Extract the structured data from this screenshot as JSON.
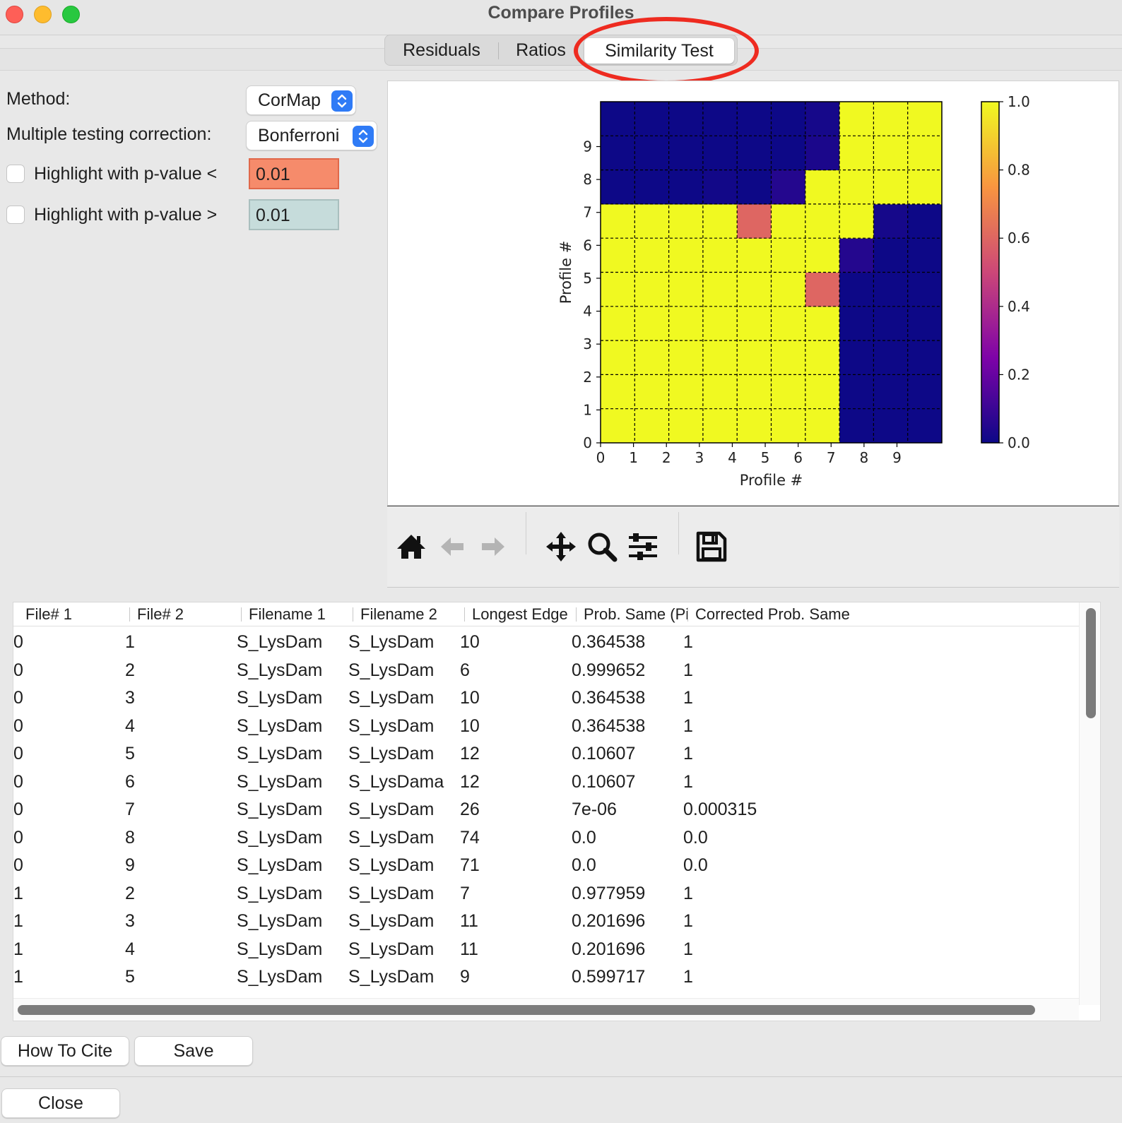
{
  "window": {
    "title": "Compare Profiles"
  },
  "tabs": [
    {
      "label": "Residuals"
    },
    {
      "label": "Ratios"
    },
    {
      "label": "Similarity Test",
      "selected": true
    }
  ],
  "controls": {
    "method_label": "Method:",
    "method_value": "CorMap",
    "correction_label": "Multiple testing correction:",
    "correction_value": "Bonferroni",
    "highlight_lt_label": "Highlight with p-value <",
    "highlight_lt_value": "0.01",
    "highlight_lt_checked": false,
    "highlight_lt_color": "#f68b6b",
    "highlight_gt_label": "Highlight with p-value >",
    "highlight_gt_value": "0.01",
    "highlight_gt_checked": false,
    "highlight_gt_color": "#c6dcdb"
  },
  "chart_data": {
    "type": "heatmap",
    "title": "",
    "xlabel": "Profile #",
    "ylabel": "Profile #",
    "x_ticks": [
      "0",
      "1",
      "2",
      "3",
      "4",
      "5",
      "6",
      "7",
      "8",
      "9"
    ],
    "y_ticks": [
      "0",
      "1",
      "2",
      "3",
      "4",
      "5",
      "6",
      "7",
      "8",
      "9"
    ],
    "xlim": [
      0,
      10
    ],
    "ylim": [
      0,
      10
    ],
    "grid": true,
    "colormap": "plasma",
    "colorbar": {
      "min": 0.0,
      "max": 1.0,
      "ticks": [
        "0.0",
        "0.2",
        "0.4",
        "0.6",
        "0.8",
        "1.0"
      ]
    },
    "matrix_rows_bottom_to_top": [
      [
        1,
        1,
        1,
        1,
        1,
        1,
        1,
        0,
        0,
        0
      ],
      [
        1,
        1,
        1,
        1,
        1,
        1,
        1,
        0,
        0,
        0
      ],
      [
        1,
        1,
        1,
        1,
        1,
        1,
        1,
        0,
        0,
        0
      ],
      [
        1,
        1,
        1,
        1,
        1,
        1,
        1,
        0,
        0,
        0
      ],
      [
        1,
        1,
        1,
        1,
        1,
        1,
        0.6,
        0,
        0,
        0
      ],
      [
        1,
        1,
        1,
        1,
        1,
        1,
        1,
        0.05,
        0,
        0
      ],
      [
        1,
        1,
        1,
        1,
        0.6,
        1,
        1,
        1,
        0.02,
        0
      ],
      [
        0,
        0,
        0,
        0.01,
        0,
        0.05,
        1,
        1,
        1,
        1
      ],
      [
        0,
        0,
        0,
        0,
        0,
        0,
        0.03,
        1,
        1,
        1
      ],
      [
        0,
        0,
        0,
        0,
        0,
        0,
        0.02,
        1,
        1,
        1
      ]
    ]
  },
  "plot_toolbar": [
    {
      "icon": "home-icon"
    },
    {
      "icon": "back-arrow-icon"
    },
    {
      "icon": "forward-arrow-icon"
    },
    {
      "icon": "pan-icon"
    },
    {
      "icon": "zoom-icon"
    },
    {
      "icon": "configure-icon"
    },
    {
      "icon": "save-icon"
    }
  ],
  "table": {
    "columns": [
      "File# 1",
      "File# 2",
      "Filename 1",
      "Filename 2",
      "Longest Edge",
      "Prob. Same (Pi",
      "Corrected Prob. Same"
    ],
    "rows": [
      [
        "0",
        "1",
        "S_LysDam",
        "S_LysDam",
        "10",
        "0.364538",
        "1"
      ],
      [
        "0",
        "2",
        "S_LysDam",
        "S_LysDam",
        "6",
        "0.999652",
        "1"
      ],
      [
        "0",
        "3",
        "S_LysDam",
        "S_LysDam",
        "10",
        "0.364538",
        "1"
      ],
      [
        "0",
        "4",
        "S_LysDam",
        "S_LysDam",
        "10",
        "0.364538",
        "1"
      ],
      [
        "0",
        "5",
        "S_LysDam",
        "S_LysDam",
        "12",
        "0.10607",
        "1"
      ],
      [
        "0",
        "6",
        "S_LysDam",
        "S_LysDama",
        "12",
        "0.10607",
        "1"
      ],
      [
        "0",
        "7",
        "S_LysDam",
        "S_LysDam",
        "26",
        "7e-06",
        "0.000315"
      ],
      [
        "0",
        "8",
        "S_LysDam",
        "S_LysDam",
        "74",
        "0.0",
        "0.0"
      ],
      [
        "0",
        "9",
        "S_LysDam",
        "S_LysDam",
        "71",
        "0.0",
        "0.0"
      ],
      [
        "1",
        "2",
        "S_LysDam",
        "S_LysDam",
        "7",
        "0.977959",
        "1"
      ],
      [
        "1",
        "3",
        "S_LysDam",
        "S_LysDam",
        "11",
        "0.201696",
        "1"
      ],
      [
        "1",
        "4",
        "S_LysDam",
        "S_LysDam",
        "11",
        "0.201696",
        "1"
      ],
      [
        "1",
        "5",
        "S_LysDam",
        "S_LysDam",
        "9",
        "0.599717",
        "1"
      ]
    ]
  },
  "buttons": {
    "how_to_cite": "How To Cite",
    "save": "Save",
    "close": "Close"
  },
  "colors": {
    "accent": "#2f7bf6",
    "tab_highlight_ring": "#ee2b20",
    "heat_yellow": "#f0f921",
    "heat_navy": "#0d0887",
    "heat_salmon": "#e16462"
  }
}
